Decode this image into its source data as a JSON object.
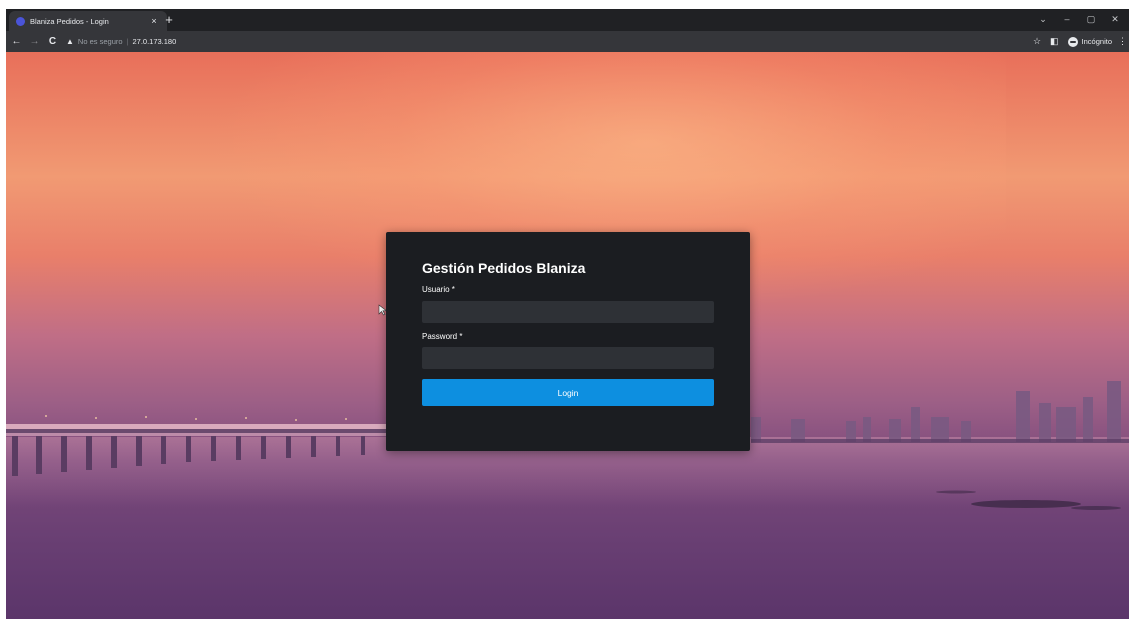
{
  "browser": {
    "tab": {
      "title": "Blaniza Pedidos - Login",
      "close_glyph": "×",
      "favicon": "globe-icon"
    },
    "new_tab_glyph": "+",
    "window_controls": [
      "⌄",
      "–",
      "▢",
      "✕"
    ],
    "nav": {
      "back_glyph": "←",
      "forward_glyph": "→",
      "reload_glyph": "C"
    },
    "address_bar": {
      "security_icon": "warning-icon",
      "security_glyph": "▲",
      "security_text": "No es seguro",
      "separator": "|",
      "url": "27.0.173.180"
    },
    "toolbar_right": {
      "bookmark_glyph": "☆",
      "sidepanel_glyph": "◧",
      "incognito_label": "Incógnito",
      "menu_glyph": "⋮"
    }
  },
  "login": {
    "title": "Gestión Pedidos Blaniza",
    "username_label": "Usuario *",
    "username_value": "",
    "password_label": "Password *",
    "password_value": "",
    "submit_label": "Login"
  },
  "colors": {
    "chrome_bg": "#202124",
    "toolbar_bg": "#35363a",
    "card_bg": "#1b1d21",
    "input_bg": "#2e3136",
    "accent": "#0d8fe0"
  }
}
